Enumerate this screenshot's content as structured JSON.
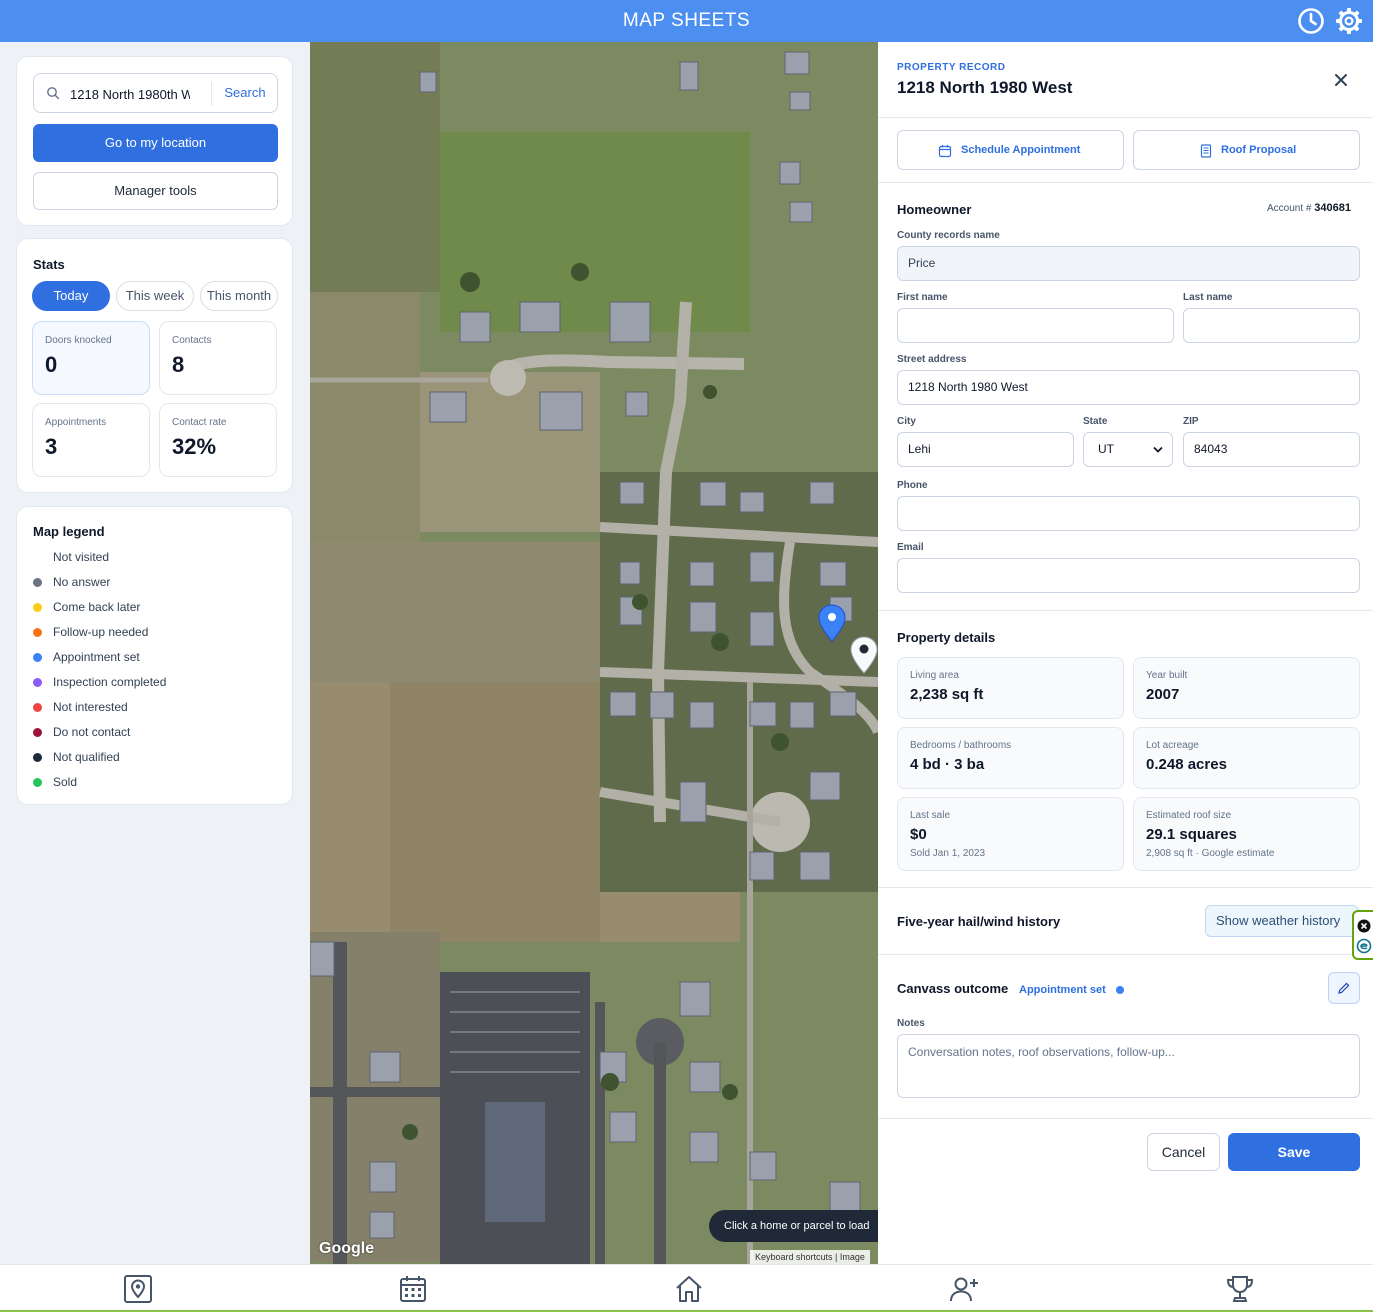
{
  "app": {
    "title": "MAP SHEETS",
    "colors": {
      "brand": "#4d8ff0",
      "primary": "#2f6fe0"
    }
  },
  "header_icons": [
    "clock-icon",
    "gear-icon"
  ],
  "search": {
    "value": "1218 North 1980th W",
    "button": "Search"
  },
  "sidebar": {
    "go_location": "Go to my location",
    "manager_tools": "Manager tools"
  },
  "stats": {
    "title": "Stats",
    "tabs": [
      "Today",
      "This week",
      "This month"
    ],
    "active_tab": "Today",
    "items": [
      {
        "label": "Doors knocked",
        "value": "0"
      },
      {
        "label": "Contacts",
        "value": "8"
      },
      {
        "label": "Appointments",
        "value": "3"
      },
      {
        "label": "Contact rate",
        "value": "32%"
      }
    ]
  },
  "legend": {
    "title": "Map legend",
    "items": [
      {
        "label": "Not visited",
        "color": "#ffffff"
      },
      {
        "label": "No answer",
        "color": "#6b7280"
      },
      {
        "label": "Come back later",
        "color": "#facc15"
      },
      {
        "label": "Follow-up needed",
        "color": "#f97316"
      },
      {
        "label": "Appointment set",
        "color": "#3b82f6"
      },
      {
        "label": "Inspection completed",
        "color": "#8b5cf6"
      },
      {
        "label": "Not interested",
        "color": "#ef4444"
      },
      {
        "label": "Do not contact",
        "color": "#9f1239"
      },
      {
        "label": "Not qualified",
        "color": "#1e293b"
      },
      {
        "label": "Sold",
        "color": "#22c55e"
      }
    ]
  },
  "map": {
    "hint": "Click a home or parcel to load",
    "logo": "Google",
    "attribution": "Keyboard shortcuts  |  Image"
  },
  "record": {
    "eyebrow": "PROPERTY RECORD",
    "title": "1218 North 1980 West",
    "schedule_btn": "Schedule Appointment",
    "roof_btn": "Roof Proposal",
    "homeowner": {
      "title": "Homeowner",
      "account_label": "Account #",
      "account_value": "340681",
      "county_label": "County records name",
      "county_value": "Price",
      "first_label": "First name",
      "first_value": "",
      "last_label": "Last name",
      "last_value": "",
      "street_label": "Street address",
      "street_value": "1218 North 1980 West",
      "city_label": "City",
      "city_value": "Lehi",
      "state_label": "State",
      "state_value": "UT",
      "zip_label": "ZIP",
      "zip_value": "84043",
      "phone_label": "Phone",
      "phone_value": "",
      "email_label": "Email",
      "email_value": ""
    },
    "details": {
      "title": "Property details",
      "items": [
        {
          "label": "Living area",
          "value": "2,238 sq ft",
          "sub": ""
        },
        {
          "label": "Year built",
          "value": "2007",
          "sub": ""
        },
        {
          "label": "Bedrooms / bathrooms",
          "value": "4 bd · 3 ba",
          "sub": ""
        },
        {
          "label": "Lot acreage",
          "value": "0.248 acres",
          "sub": ""
        },
        {
          "label": "Last sale",
          "value": "$0",
          "sub": "Sold Jan 1, 2023"
        },
        {
          "label": "Estimated roof size",
          "value": "29.1 squares",
          "sub": "2,908 sq ft · Google estimate"
        }
      ]
    },
    "weather": {
      "title": "Five-year hail/wind history",
      "button": "Show weather history"
    },
    "outcome": {
      "title": "Canvass outcome",
      "status": "Appointment set",
      "notes_label": "Notes",
      "notes_placeholder": "Conversation notes, roof observations, follow-up..."
    },
    "cancel": "Cancel",
    "save": "Save"
  },
  "bottom_nav": [
    "map-pin-icon",
    "calendar-icon",
    "home-icon",
    "add-user-icon",
    "trophy-icon"
  ]
}
